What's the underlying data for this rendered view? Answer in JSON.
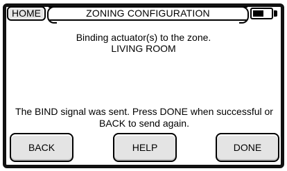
{
  "header": {
    "home_label": "HOME",
    "title": "ZONING CONFIGURATION",
    "battery_level": 0.6
  },
  "message": {
    "line1": "Binding actuator(s) to the zone.",
    "line2": "LIVING ROOM"
  },
  "status": {
    "line1": "The BIND signal was sent. Press DONE when successful or",
    "line2": "BACK to send again."
  },
  "buttons": {
    "back": "BACK",
    "help": "HELP",
    "done": "DONE"
  }
}
